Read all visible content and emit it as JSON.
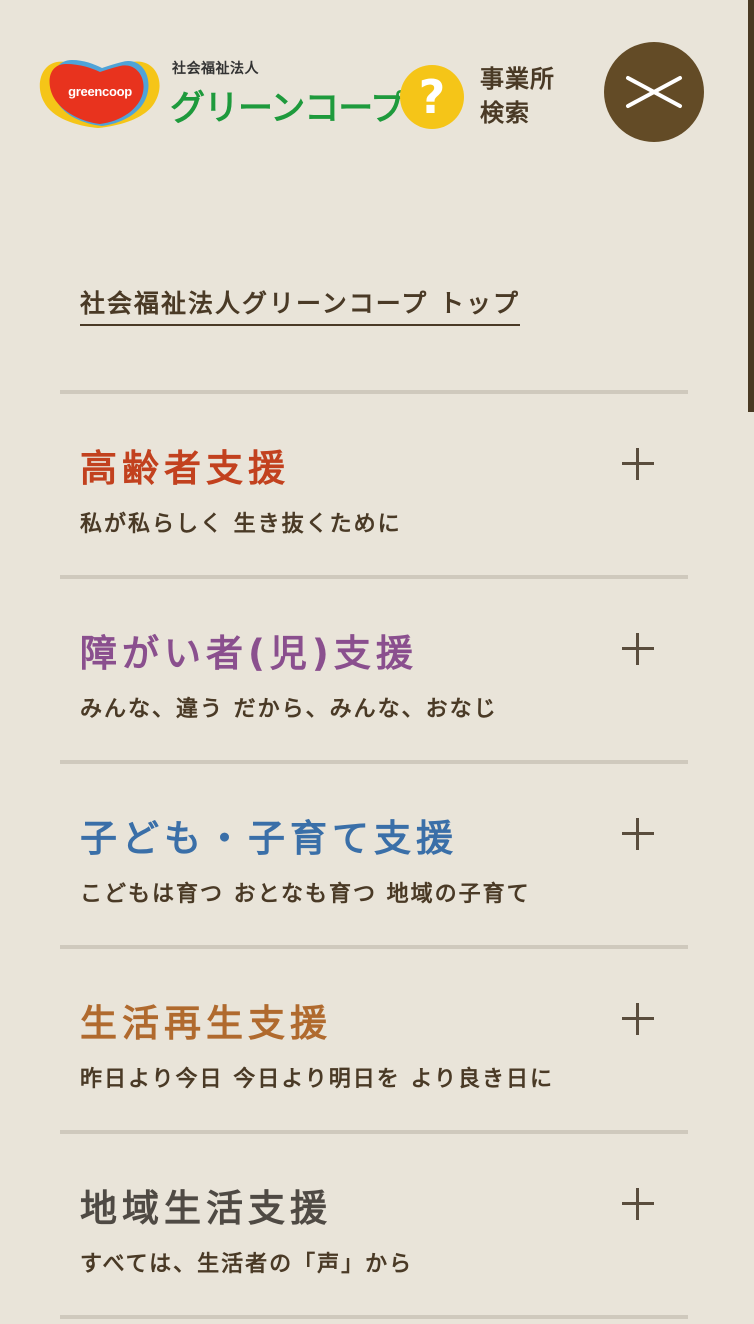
{
  "header": {
    "logo": {
      "mark_text": "greencoop",
      "subtitle": "社会福祉法人",
      "title": "グリーンコープ"
    },
    "search": {
      "icon": "question-mark-icon",
      "icon_glyph": "?",
      "label": "事業所検索"
    },
    "close": {
      "icon": "close-icon"
    }
  },
  "top_link": {
    "label": "社会福祉法人グリーンコープ トップ"
  },
  "menu": {
    "items": [
      {
        "title": "高齢者支援",
        "subtitle": "私が私らしく 生き抜くために",
        "color": "#c2411e"
      },
      {
        "title": "障がい者(児)支援",
        "subtitle": "みんな、違う だから、みんな、おなじ",
        "color": "#8a4f8e"
      },
      {
        "title": "子ども・子育て支援",
        "subtitle": "こどもは育つ おとなも育つ 地域の子育て",
        "color": "#3a6fa8"
      },
      {
        "title": "生活再生支援",
        "subtitle": "昨日より今日 今日より明日を より良き日に",
        "color": "#b06a2e"
      },
      {
        "title": "地域生活支援",
        "subtitle": "すべては、生活者の「声」から",
        "color": "#4f4a44"
      }
    ]
  },
  "colors": {
    "background": "#e9e4d9",
    "text": "#4a3a26",
    "accent_close": "#634b26",
    "search_icon": "#f5c518",
    "logo_green": "#1e9a3c",
    "divider": "#cfc9bd"
  }
}
